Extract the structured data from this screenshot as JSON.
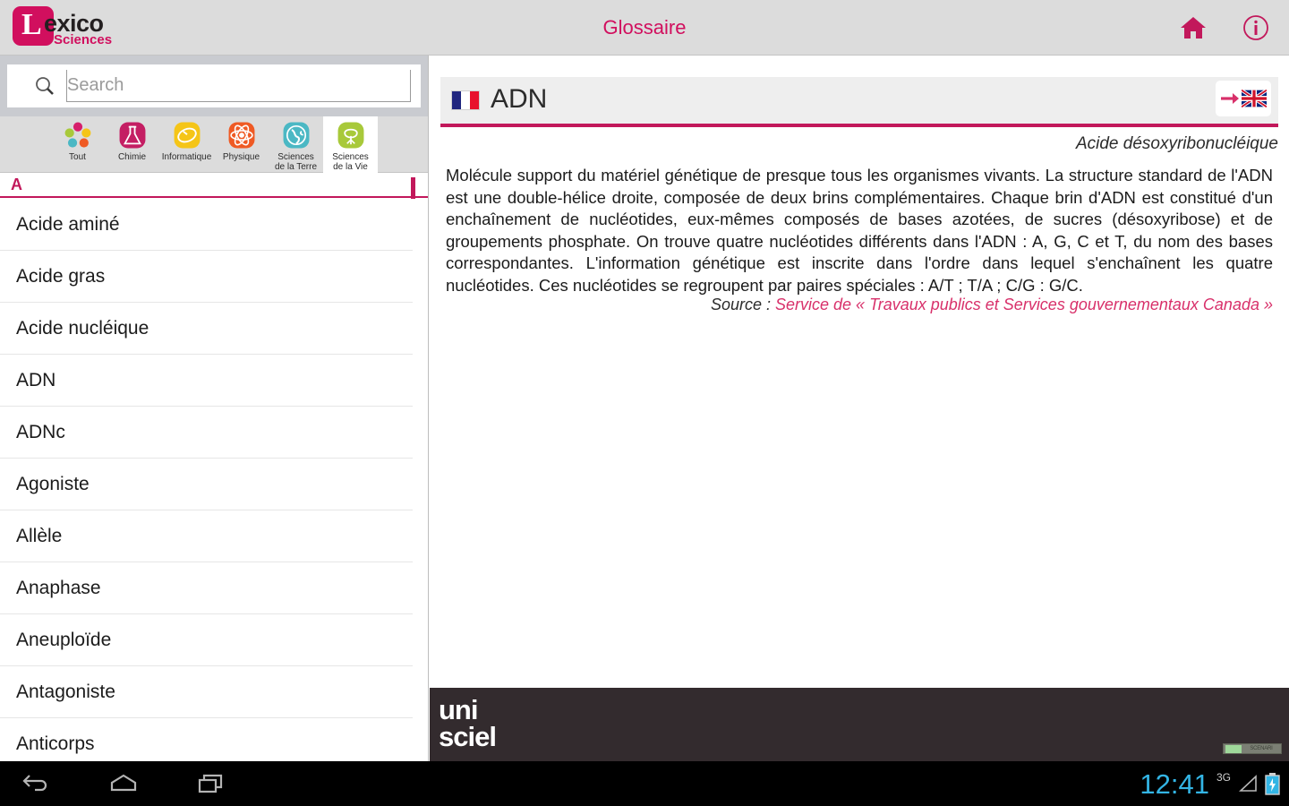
{
  "header": {
    "logo_main": "exico",
    "logo_letter": "L",
    "logo_sub": "Sciences",
    "title": "Glossaire",
    "home_icon": "home-icon",
    "info_icon": "info-icon"
  },
  "search": {
    "placeholder": "Search",
    "value": "",
    "icon": "search-icon"
  },
  "categories": [
    {
      "label": "Tout",
      "icon": "all-categories-icon",
      "selected": false
    },
    {
      "label": "Chimie",
      "icon": "flask-icon",
      "selected": false
    },
    {
      "label": "Informatique",
      "icon": "mouse-icon",
      "selected": false
    },
    {
      "label": "Physique",
      "icon": "atom-icon",
      "selected": false
    },
    {
      "label": "Sciences\nde la Terre",
      "icon": "globe-icon",
      "selected": false
    },
    {
      "label": "Sciences\nde la Vie",
      "icon": "tree-icon",
      "selected": true
    }
  ],
  "list": {
    "section_letter": "A",
    "items": [
      "Acide aminé",
      "Acide gras",
      "Acide nucléique",
      "ADN",
      "ADNc",
      "Agoniste",
      "Allèle",
      "Anaphase",
      "Aneuploïde",
      "Antagoniste",
      "Anticorps"
    ]
  },
  "entry": {
    "flag_source": "french-flag",
    "title": "ADN",
    "translate_icon": "arrow-right-icon",
    "flag_target": "uk-flag",
    "subtitle": "Acide désoxyribonucléique",
    "definition": "Molécule support du matériel génétique de presque tous les organismes vivants. La structure standard de l'ADN est une double-hélice droite, composée de deux brins complémentaires. Chaque brin d'ADN est constitué d'un enchaînement de nucléotides, eux-mêmes composés de bases azotées, de sucres (désoxyribose) et de groupements phosphate. On trouve quatre nucléotides différents dans l'ADN : A, G, C et T, du nom des bases correspondantes. L'information génétique est inscrite dans l'ordre dans lequel s'enchaînent les quatre nucléotides. Ces nucléotides se regroupent par paires spéciales : A/T ; T/A ; C/G : G/C.",
    "source_label": "Source :",
    "source_value": "Service de « Travaux publics et Services gouvernementaux Canada »"
  },
  "footer": {
    "logo_line1": "uni",
    "logo_line2": "sciel",
    "badge_text": "SCENARI"
  },
  "navbar": {
    "back_icon": "back-icon",
    "home_icon": "home-icon",
    "recents_icon": "recent-apps-icon",
    "clock": "12:41",
    "network": "3G",
    "signal_icon": "signal-icon",
    "battery_icon": "battery-charging-icon"
  },
  "colors": {
    "accent": "#c2185b",
    "brand": "#d10f5e",
    "clock": "#33b5e5"
  }
}
